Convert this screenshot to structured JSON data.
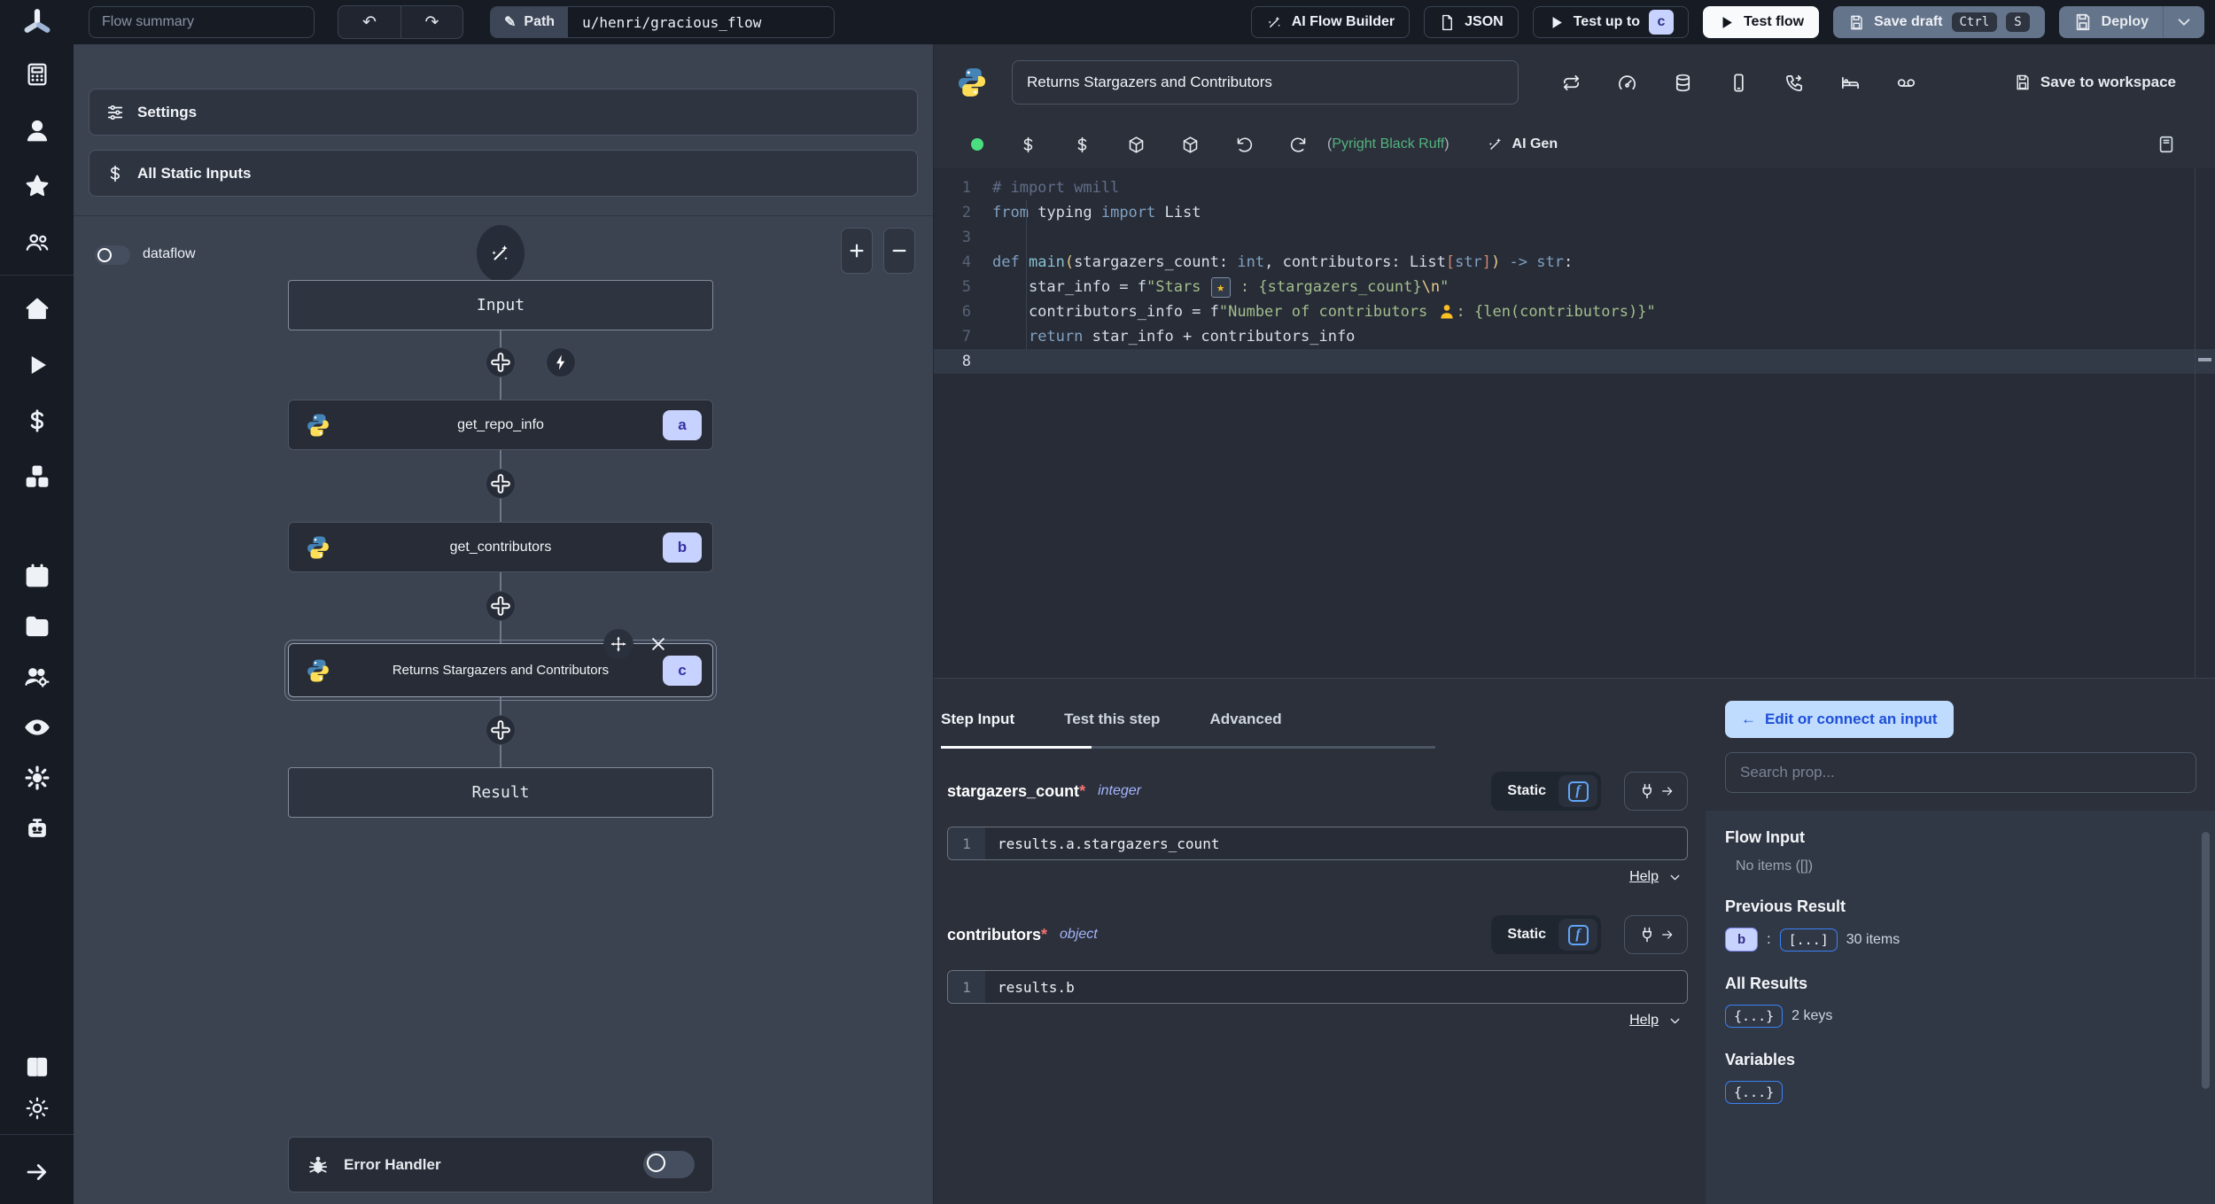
{
  "icons": {
    "pencil": "✎",
    "undo": "↶",
    "redo": "↷",
    "back_arrow": "←",
    "function": "f"
  },
  "sidebar": {
    "logo": "windmill-logo",
    "groups": [
      {
        "items": [
          "apps",
          "user",
          "favorites",
          "groups"
        ]
      },
      {
        "items": [
          "home",
          "runs",
          "variables",
          "resources"
        ]
      },
      {
        "items": [
          "schedules",
          "folders",
          "workers",
          "audit-logs",
          "settings",
          "ai"
        ]
      },
      {
        "items": [
          "docs",
          "theme-toggle"
        ]
      },
      {
        "items": [
          "expand"
        ]
      }
    ]
  },
  "topbar": {
    "flow_summary_placeholder": "Flow summary",
    "path_label": "Path",
    "path_value": "u/henri/gracious_flow",
    "ai_flow_builder": "AI Flow Builder",
    "json": "JSON",
    "test_up_to": "Test up to",
    "test_up_to_badge": "c",
    "test_flow": "Test flow",
    "save_draft": "Save draft",
    "kbd_ctrl": "Ctrl",
    "kbd_s": "S",
    "deploy": "Deploy"
  },
  "flow_panel": {
    "settings": "Settings",
    "all_static_inputs": "All Static Inputs",
    "dataflow": "dataflow",
    "nodes": {
      "input": "Input",
      "a": {
        "label": "get_repo_info",
        "badge": "a"
      },
      "b": {
        "label": "get_contributors",
        "badge": "b"
      },
      "c": {
        "label": "Returns Stargazers and Contributors",
        "badge": "c"
      },
      "result": "Result"
    },
    "error_handler": "Error Handler"
  },
  "step_editor": {
    "title_value": "Returns Stargazers and Contributors",
    "save_to_workspace": "Save to workspace",
    "assistants_prefix": "(",
    "assistants": "Pyright Black Ruff",
    "assistants_suffix": ")",
    "ai_gen": "AI Gen"
  },
  "code": {
    "lines": [
      {
        "n": "1",
        "tokens": [
          {
            "t": "# import wmill",
            "c": "cm"
          }
        ]
      },
      {
        "n": "2",
        "tokens": [
          {
            "t": "from",
            "c": "kw"
          },
          {
            "t": " typing ",
            "c": "tx"
          },
          {
            "t": "import",
            "c": "kw"
          },
          {
            "t": " List",
            "c": "tx"
          }
        ]
      },
      {
        "n": "3",
        "tokens": []
      },
      {
        "n": "4",
        "tokens": [
          {
            "t": "def",
            "c": "kw"
          },
          {
            "t": " ",
            "c": "tx"
          },
          {
            "t": "main",
            "c": "fn"
          },
          {
            "t": "(",
            "c": "py"
          },
          {
            "t": "stargazers_count: ",
            "c": "tx"
          },
          {
            "t": "int",
            "c": "kw"
          },
          {
            "t": ", contributors: List",
            "c": "tx"
          },
          {
            "t": "[",
            "c": "pr"
          },
          {
            "t": "str",
            "c": "kw"
          },
          {
            "t": "]",
            "c": "pr"
          },
          {
            "t": ")",
            "c": "py"
          },
          {
            "t": " -> ",
            "c": "kw"
          },
          {
            "t": "str",
            "c": "kw"
          },
          {
            "t": ":",
            "c": "tx"
          }
        ]
      },
      {
        "n": "5",
        "tokens": [
          {
            "t": "    star_info = f",
            "c": "tx"
          },
          {
            "t": "\"Stars ",
            "c": "st"
          },
          {
            "t": "★",
            "c": "ems"
          },
          {
            "t": " : {stargazers_count}",
            "c": "st"
          },
          {
            "t": "\\n",
            "c": "esc"
          },
          {
            "t": "\"",
            "c": "st"
          }
        ]
      },
      {
        "n": "6",
        "tokens": [
          {
            "t": "    contributors_info = f",
            "c": "tx"
          },
          {
            "t": "\"Number of contributors ",
            "c": "st"
          },
          {
            "t": "person",
            "c": "emp"
          },
          {
            "t": ": {len(contributors)}\"",
            "c": "st"
          }
        ]
      },
      {
        "n": "7",
        "tokens": [
          {
            "t": "    ",
            "c": "tx"
          },
          {
            "t": "return",
            "c": "kw"
          },
          {
            "t": " star_info + contributors_info",
            "c": "tx"
          }
        ]
      },
      {
        "n": "8",
        "active": true,
        "tokens": []
      }
    ]
  },
  "tabs": {
    "step_input": "Step Input",
    "test_this_step": "Test this step",
    "advanced": "Advanced"
  },
  "form": {
    "fields": [
      {
        "name": "stargazers_count",
        "required": "*",
        "type": "integer",
        "mode": "Static",
        "line_no": "1",
        "code": "results.a.stargazers_count",
        "help": "Help"
      },
      {
        "name": "contributors",
        "required": "*",
        "type": "object",
        "mode": "Static",
        "line_no": "1",
        "code": "results.b",
        "help": "Help"
      }
    ]
  },
  "prop_panel": {
    "back_button": "Edit or connect an input",
    "search_placeholder": "Search prop...",
    "flow_input": {
      "title": "Flow Input",
      "empty": "No items ([])"
    },
    "previous_result": {
      "title": "Previous Result",
      "key_badge": "b",
      "sep": ":",
      "array_badge": "[...]",
      "count": "30 items"
    },
    "all_results": {
      "title": "All Results",
      "brace_badge": "{...}",
      "count": "2 keys"
    },
    "variables": {
      "title": "Variables",
      "brace_badge": "{...}"
    }
  }
}
